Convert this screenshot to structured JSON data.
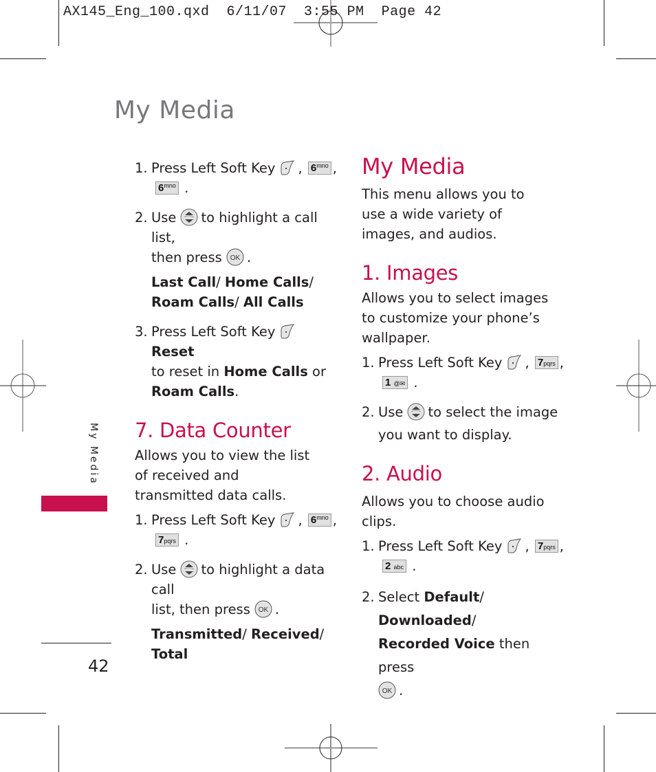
{
  "slug": "AX145_Eng_100.qxd  6/11/07  3:55 PM  Page 42",
  "page_title": "My Media",
  "side_label": "My Media",
  "page_number": "42",
  "colors": {
    "accent": "#c8104e",
    "title_gray": "#77787b",
    "text": "#231f20",
    "key_bg": "#e0e0e0"
  },
  "icons": {
    "soft_key": "left-soft-key-icon",
    "nav_key": "up-down-nav-icon",
    "ok_key": "ok-key-icon"
  },
  "left": {
    "call_timer": {
      "step1": {
        "num": "1.",
        "text": "Press Left Soft Key",
        "keys": [
          {
            "digit": "6",
            "letters": "mno"
          },
          {
            "digit": "6",
            "letters": "mno"
          }
        ]
      },
      "step2": {
        "num": "2.",
        "pre": "Use",
        "mid": "to highlight a call list,",
        "line2": "then press",
        "end": "."
      },
      "options": {
        "o1": "Last Call",
        "o2": "Home Calls",
        "o3": "Roam Calls",
        "o4": "All Calls",
        "sep": "/ "
      },
      "step3": {
        "num": "3.",
        "text": "Press Left Soft Key",
        "reset": "Reset",
        "line2a": "to reset in",
        "home": "Home Calls",
        "or": "or",
        "roam": "Roam Calls",
        "end": "."
      }
    },
    "data_counter": {
      "heading": "7. Data Counter",
      "desc": "Allows you to view the list of received and transmitted data calls.",
      "step1": {
        "num": "1.",
        "text": "Press Left Soft Key",
        "keys": [
          {
            "digit": "6",
            "letters": "mno"
          },
          {
            "digit": "7",
            "letters": "pqrs"
          }
        ]
      },
      "step2": {
        "num": "2.",
        "pre": "Use",
        "mid": "to highlight a data call",
        "line2": "list, then press",
        "end": "."
      },
      "options": {
        "o1": "Transmitted",
        "o2": "Received",
        "o3": "Total",
        "sep": "/ "
      }
    }
  },
  "right": {
    "my_media": {
      "heading": "My Media",
      "desc": "This menu allows you to use a wide variety of images, and audios."
    },
    "images": {
      "heading": "1. Images",
      "desc": "Allows you to select images to customize your phone’s wallpaper.",
      "step1": {
        "num": "1.",
        "text": "Press Left Soft Key",
        "keys": [
          {
            "digit": "7",
            "letters": "pqrs"
          },
          {
            "digit": "1",
            "letters": "@✉"
          }
        ]
      },
      "step2": {
        "num": "2.",
        "pre": "Use",
        "mid": "to select the image",
        "line2": "you want to display."
      }
    },
    "audio": {
      "heading": "2. Audio",
      "desc": "Allows you to choose audio clips.",
      "step1": {
        "num": "1.",
        "text": "Press Left Soft Key",
        "keys": [
          {
            "digit": "7",
            "letters": "pqrs"
          },
          {
            "digit": "2",
            "letters": "abc"
          }
        ]
      },
      "step2": {
        "num": "2.",
        "pre": "Select",
        "o1": "Default",
        "o2": "Downloaded",
        "o3": "Recorded Voice",
        "sep": "/ ",
        "post": "then press",
        "end": "."
      }
    }
  },
  "punct": {
    "comma": ",",
    "period": "."
  }
}
